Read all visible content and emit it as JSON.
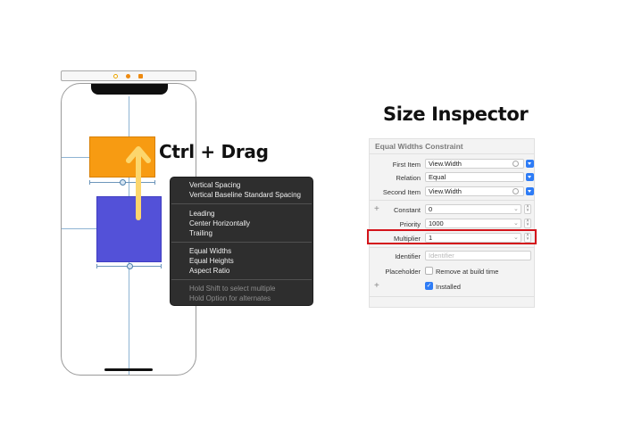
{
  "drag_label": "Ctrl + Drag",
  "context_menu": {
    "groups": [
      [
        "Vertical Spacing",
        "Vertical Baseline Standard Spacing"
      ],
      [
        "Leading",
        "Center Horizontally",
        "Trailing"
      ],
      [
        "Equal Widths",
        "Equal Heights",
        "Aspect Ratio"
      ]
    ],
    "hints": [
      "Hold Shift to select multiple",
      "Hold Option for alternates"
    ]
  },
  "inspector": {
    "title": "Size Inspector",
    "header": "Equal Widths Constraint",
    "first_item": {
      "label": "First Item",
      "value": "View.Width"
    },
    "relation": {
      "label": "Relation",
      "value": "Equal"
    },
    "second_item": {
      "label": "Second Item",
      "value": "View.Width"
    },
    "constant": {
      "label": "Constant",
      "value": "0"
    },
    "priority": {
      "label": "Priority",
      "value": "1000"
    },
    "multiplier": {
      "label": "Multiplier",
      "value": "1"
    },
    "identifier": {
      "label": "Identifier",
      "placeholder": "Identifier"
    },
    "placeholder": {
      "label": "Placeholder",
      "checkbox_label": "Remove at build time",
      "checked": false
    },
    "installed": {
      "checkbox_label": "Installed",
      "checked": true
    }
  },
  "colors": {
    "orange_view": "#f79b12",
    "blue_view": "#5351d8",
    "drag_arrow": "#fcd66d",
    "menu_bg": "#2e2e2e",
    "accent_blue": "#2e7cf6",
    "highlight_red": "#d4141b"
  }
}
